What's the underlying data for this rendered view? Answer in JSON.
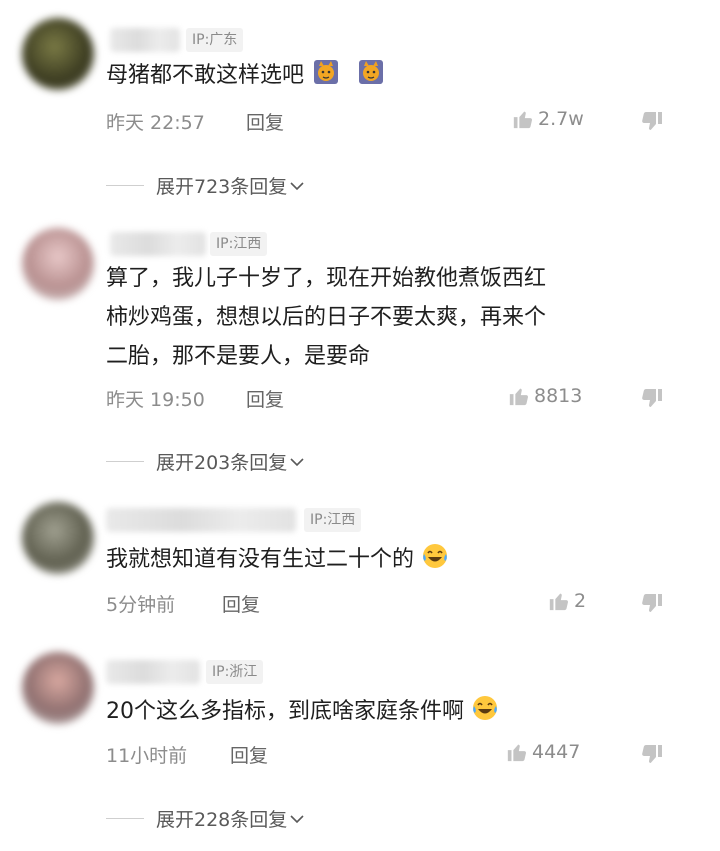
{
  "comments": [
    {
      "ip": "IP:广东",
      "text": "母猪都不敢这样选吧",
      "emojis": [
        "cat-emoji",
        "cat-emoji"
      ],
      "time": "昨天 22:57",
      "reply": "回复",
      "likes": "2.7w",
      "expand": "展开723条回复"
    },
    {
      "ip": "IP:江西",
      "text_lines": [
        "算了，我儿子十岁了，现在开始教他煮饭西红",
        "柿炒鸡蛋，想想以后的日子不要太爽，再来个",
        "二胎，那不是要人，是要命"
      ],
      "time": "昨天 19:50",
      "reply": "回复",
      "likes": "8813",
      "expand": "展开203条回复"
    },
    {
      "ip": "IP:江西",
      "text": "我就想知道有没有生过二十个的",
      "emojis": [
        "laughing-tears-emoji"
      ],
      "time": "5分钟前",
      "reply": "回复",
      "likes": "2"
    },
    {
      "ip": "IP:浙江",
      "text": "20个这么多指标，到底啥家庭条件啊",
      "emojis": [
        "laughing-tears-emoji"
      ],
      "time": "11小时前",
      "reply": "回复",
      "likes": "4447",
      "expand": "展开228条回复"
    }
  ],
  "icons": {
    "like": "thumbs-up-icon",
    "dislike": "thumbs-down-icon",
    "expand": "chevron-down-icon"
  },
  "colors": {
    "text": "#1f1f1f",
    "meta": "#8c8c8c",
    "badge_bg": "#f2f2f2"
  }
}
